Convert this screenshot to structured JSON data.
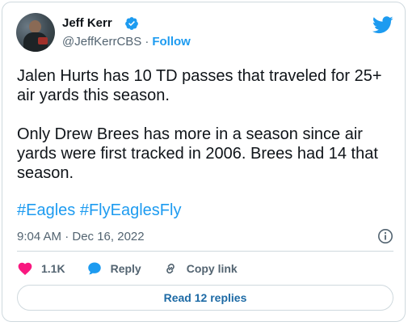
{
  "author": {
    "name": "Jeff Kerr",
    "handle": "@JeffKerrCBS",
    "separator": "·",
    "follow_label": "Follow",
    "verified": true
  },
  "tweet": {
    "paragraph_1": "Jalen Hurts has 10 TD passes that traveled for 25+ air yards this season.",
    "paragraph_2": "Only Drew Brees has more in a season since air yards were first tracked in 2006. Brees had 14 that season.",
    "hashtags": [
      "#Eagles",
      "#FlyEaglesFly"
    ],
    "timestamp": "9:04 AM · Dec 16, 2022"
  },
  "actions": {
    "like_count": "1.1K",
    "reply_label": "Reply",
    "copy_link_label": "Copy link"
  },
  "read_replies_label": "Read 12 replies",
  "colors": {
    "accent": "#1d9bf0",
    "like": "#f91880",
    "text": "#0f1419",
    "muted": "#536471",
    "border": "#cfd9de"
  },
  "icons": [
    "avatar",
    "verified-badge-icon",
    "twitter-bird-icon",
    "info-icon",
    "heart-icon",
    "reply-bubble-icon",
    "link-icon"
  ]
}
